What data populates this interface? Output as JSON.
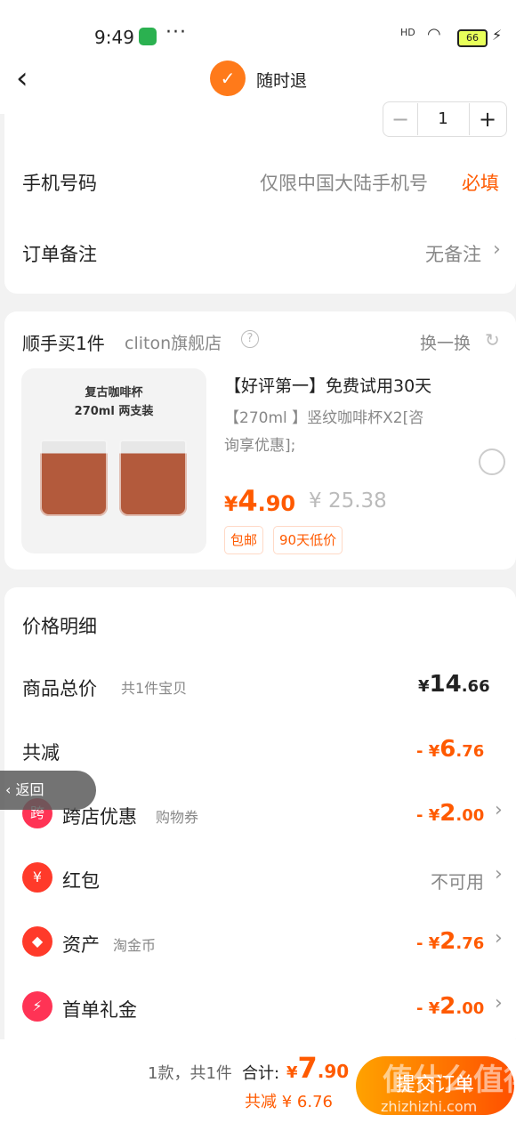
{
  "status_bar": {
    "time": "9:49",
    "more": "···",
    "network": "HD",
    "battery": "66",
    "charging": "⚡"
  },
  "nav": {
    "title": "随时退"
  },
  "quantity": {
    "minus": "−",
    "value": "1",
    "plus": "+"
  },
  "form": {
    "phone": {
      "label": "手机号码",
      "placeholder": "仅限中国大陆手机号",
      "required": "必填"
    },
    "note": {
      "label": "订单备注",
      "value": "无备注"
    }
  },
  "addon": {
    "title": "顺手买1件",
    "store": "cliton旗舰店",
    "refresh": "换一换",
    "image_text_1": "复古咖啡杯",
    "image_text_2": "270ml 两支装",
    "name": "【好评第一】免费试用30天",
    "desc_1": "【270ml 】竖纹咖啡杯X2[咨",
    "desc_2": "询享优惠];",
    "price_symbol": "¥",
    "price_int": "4",
    "price_dec": ".90",
    "orig_price": "¥ 25.38",
    "tags": [
      "包邮",
      "90天低价"
    ]
  },
  "price_detail": {
    "title": "价格明细",
    "total_label": "商品总价",
    "total_sub": "共1件宝贝",
    "total_symbol": "¥",
    "total_int": "14",
    "total_dec": ".66",
    "reduce_label": "共减",
    "reduce_value_sign": "- ¥",
    "reduce_value_int": "6",
    "reduce_value_dec": ".76",
    "items": [
      {
        "icon_text": "跨",
        "label": "跨店优惠",
        "sub": "购物券",
        "sign": "- ¥",
        "int": "2",
        "dec": ".00"
      },
      {
        "icon_text": "¥",
        "label": "红包",
        "sub": "",
        "value": "不可用"
      },
      {
        "icon_text": "◆",
        "label": "资产",
        "sub": "淘金币",
        "sign": "- ¥",
        "int": "2",
        "dec": ".76"
      },
      {
        "icon_text": "⚡",
        "label": "首单礼金",
        "sub": "",
        "sign": "- ¥",
        "int": "2",
        "dec": ".00"
      }
    ]
  },
  "back_float": "返回",
  "bottom": {
    "count": "1款，共1件",
    "total_label": "合计:",
    "total_symbol": "¥",
    "total_int": "7",
    "total_dec": ".90",
    "reduce": "共减 ¥ 6.76",
    "submit": "提交订单",
    "watermark": "值什么值得买",
    "watermark_url": "zhizhizhi.com"
  },
  "colors": {
    "accent": "#ff5a00",
    "muted": "#888888",
    "bg": "#f2f2f2"
  }
}
